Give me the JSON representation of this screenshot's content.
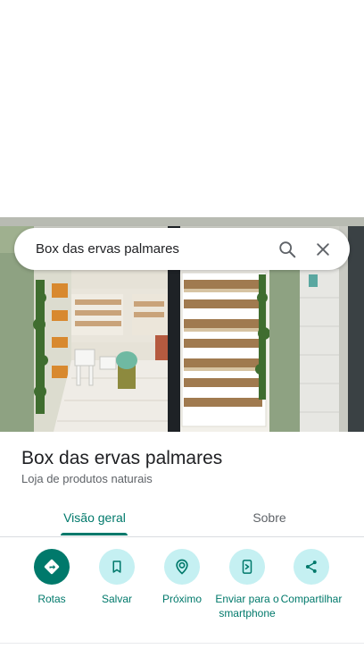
{
  "search": {
    "query": "Box das ervas palmares",
    "search_icon": "search-icon",
    "close_icon": "close-icon"
  },
  "place": {
    "name": "Box das ervas palmares",
    "category": "Loja de produtos naturais"
  },
  "tabs": [
    {
      "label": "Visão geral",
      "active": true
    },
    {
      "label": "Sobre",
      "active": false
    }
  ],
  "actions": [
    {
      "label": "Rotas",
      "icon": "directions-icon"
    },
    {
      "label": "Salvar",
      "icon": "bookmark-icon"
    },
    {
      "label": "Próximo",
      "icon": "nearby-icon"
    },
    {
      "label": "Enviar para o smartphone",
      "icon": "send-to-phone-icon"
    },
    {
      "label": "Compartilhar",
      "icon": "share-icon"
    }
  ],
  "colors": {
    "accent": "#00796b",
    "action_bg": "#c5f0f2",
    "text_primary": "#202124",
    "text_secondary": "#5f6368"
  }
}
